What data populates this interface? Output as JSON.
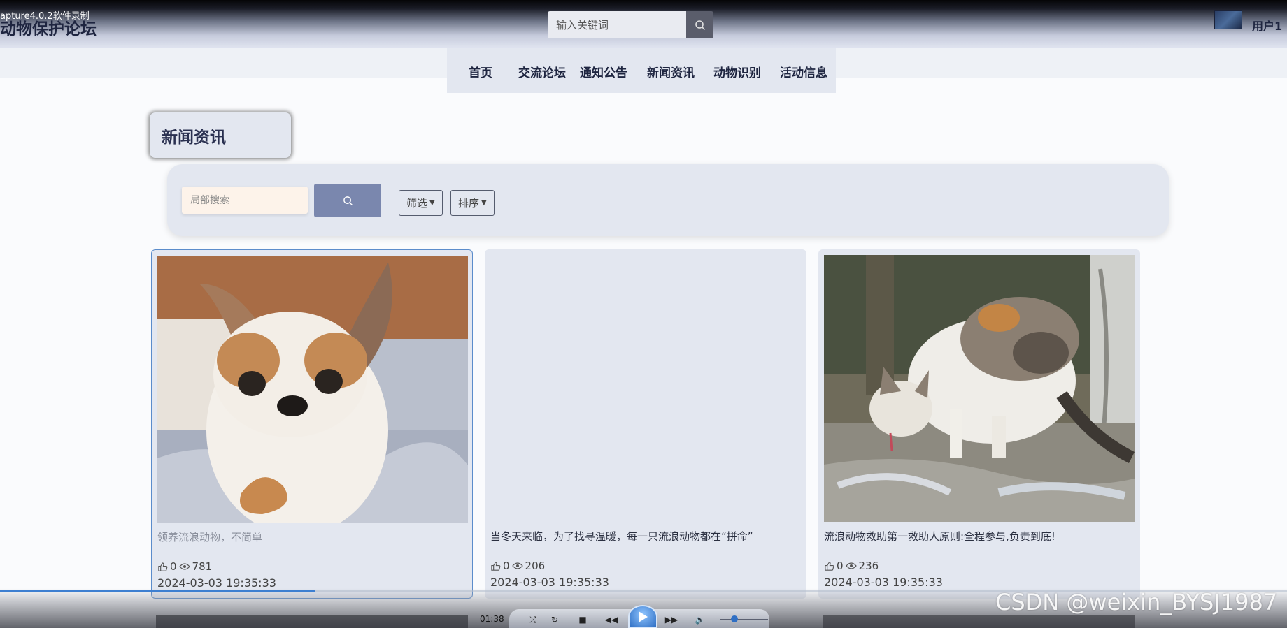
{
  "recorder_label": "apture4.0.2软件录制",
  "header": {
    "site_title": "动物保护论坛",
    "search_placeholder": "输入关键词",
    "username": "用户1"
  },
  "nav": {
    "items": [
      {
        "label": "首页"
      },
      {
        "label": "交流论坛"
      },
      {
        "label": "通知公告"
      },
      {
        "label": "新闻资讯"
      },
      {
        "label": "动物识别"
      },
      {
        "label": "活动信息"
      }
    ]
  },
  "section": {
    "title": "新闻资讯"
  },
  "filters": {
    "search_placeholder": "局部搜索",
    "filter_label": "筛选",
    "sort_label": "排序"
  },
  "cards": [
    {
      "title": "领养流浪动物，不简单",
      "likes": "0",
      "views": "781",
      "date": "2024-03-03 19:35:33",
      "image": "chihuahua-photo"
    },
    {
      "title": "当冬天来临，为了找寻温暖，每一只流浪动物都在“拼命”",
      "likes": "0",
      "views": "206",
      "date": "2024-03-03 19:35:33",
      "image": "none"
    },
    {
      "title": "流浪动物救助第一救助人原则:全程参与,负责到底!",
      "likes": "0",
      "views": "236",
      "date": "2024-03-03 19:35:33",
      "image": "cat-drinking-photo"
    }
  ],
  "player": {
    "time": "01:38",
    "progress": 0.245,
    "volume": 0.3
  },
  "watermark": "CSDN @weixin_BYSJ1987",
  "colors": {
    "nav_bg": "#e3e7f0",
    "accent": "#7a87ae",
    "title_text": "#1e2540",
    "active_border": "#5b8ccb"
  }
}
